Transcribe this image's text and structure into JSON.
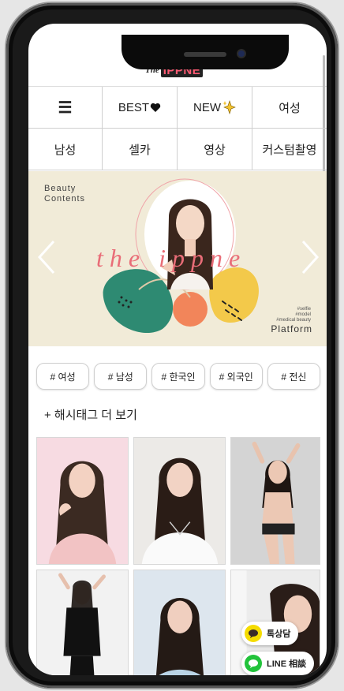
{
  "logo": {
    "prefix": "The",
    "name": "IPPNE"
  },
  "nav": {
    "row1": [
      "BEST",
      "NEW",
      "여성"
    ],
    "row2": [
      "남성",
      "셀카",
      "영상",
      "커스텀촬영"
    ],
    "menu_icon": "menu-icon",
    "best_icon": "heart-icon",
    "new_icon": "sparkle-icon"
  },
  "banner": {
    "label_line1": "Beauty",
    "label_line2": "Contents",
    "wordmark": "the ippne",
    "tags_line1": "#selfie",
    "tags_line2": "#model",
    "tags_line3": "#medical beauty",
    "platform": "Platform"
  },
  "hashtags": [
    "# 여성",
    "# 남성",
    "# 한국인",
    "# 외국인",
    "# 전신"
  ],
  "more_hashtags": "+ 해시태그 더 보기",
  "floating": {
    "kakao": "톡상담",
    "line": "LINE 相談"
  },
  "colors": {
    "accent": "#e96d78",
    "kakao": "#f5dc00",
    "line": "#22c33b",
    "banner_bg": "#f1ebd8"
  }
}
